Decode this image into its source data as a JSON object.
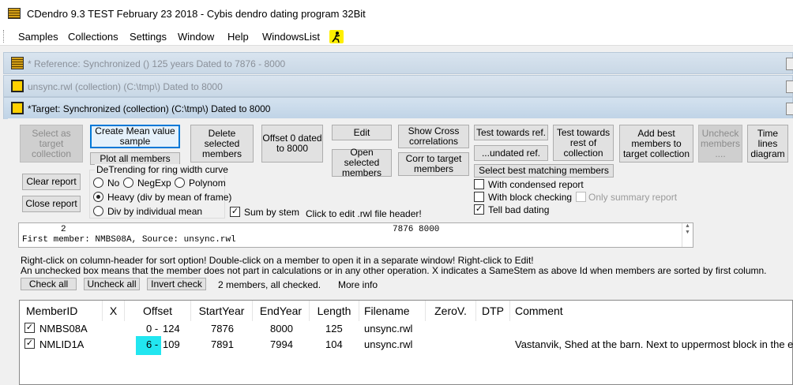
{
  "window": {
    "title": "CDendro 9.3  TEST February 23 2018 - Cybis dendro dating program  32Bit"
  },
  "menu": [
    {
      "key": "samples",
      "label": "Samples"
    },
    {
      "key": "collections",
      "label": "Collections"
    },
    {
      "key": "settings",
      "label": "Settings"
    },
    {
      "key": "window",
      "label": "Window"
    },
    {
      "key": "help",
      "label": "Help"
    },
    {
      "key": "windowslist",
      "label": "WindowsList"
    }
  ],
  "mdi": {
    "reference": "* Reference: Synchronized    ()  125 years  Dated to 7876 - 8000",
    "unsync": "unsync.rwl (collection)  (C:\\tmp\\) Dated to 8000",
    "target": "*Target: Synchronized (collection)  (C:\\tmp\\) Dated to 8000"
  },
  "buttons": {
    "select_target": "Select as target collection",
    "create_mean": "Create Mean value sample",
    "plot_all": "Plot all members",
    "delete_selected": "Delete selected members",
    "offset0": "Offset 0 dated to 8000",
    "edit": "Edit",
    "open_selected": "Open selected members",
    "show_cross": "Show Cross correlations",
    "corr_target": "Corr to target members",
    "test_ref": "Test towards ref.",
    "undated_ref": "...undated ref.",
    "test_rest": "Test towards rest of collection",
    "add_best": "Add best members to target collection",
    "uncheck_members": "Uncheck members ....",
    "time_lines": "Time lines diagram",
    "select_best": "Select best matching members",
    "clear_report": "Clear report",
    "close_report": "Close report",
    "check_all": "Check all",
    "uncheck_all": "Uncheck all",
    "invert_check": "Invert check"
  },
  "detrending": {
    "title": "DeTrending for ring width curve",
    "options": [
      "No",
      "NegExp",
      "Polynom",
      "Heavy (div by mean of frame)",
      "Div by individual mean"
    ],
    "selected": "Heavy (div by mean of frame)"
  },
  "checks": {
    "sum_by_stem": "Sum by stem",
    "condensed": "With condensed report",
    "block": "With block checking",
    "summary_only": "Only summary report",
    "tell_bad": "Tell bad dating"
  },
  "labels": {
    "click_edit": "Click to edit .rwl file header!",
    "hint1": "Right-click on column-header for sort option! Double-click on a member to open it in a separate window! Right-click to Edit!",
    "hint2": "An unchecked box means that the member does not part in calculations or in any other operation.  X indicates a SameStem as above Id when members are sorted by first column.",
    "status": "2 members, all checked.",
    "more_info": "More info"
  },
  "report": {
    "line1_a": "2",
    "line1_b": "7876 8000",
    "line2": "First member: NMBS08A, Source: unsync.rwl"
  },
  "table": {
    "columns": [
      "MemberID",
      "X",
      "Offset",
      "StartYear",
      "EndYear",
      "Length",
      "Filename",
      "ZeroV.",
      "DTP",
      "Comment"
    ],
    "rows": [
      {
        "checked": true,
        "id": "NMBS08A",
        "x": "",
        "offset_a": "0 -",
        "offset_b": "124",
        "start": "7876",
        "end": "8000",
        "length": "125",
        "file": "unsync.rwl",
        "zero": "",
        "dtp": "",
        "comment": ""
      },
      {
        "checked": true,
        "id": "NMLID1A",
        "x": "",
        "offset_a": "6 -",
        "offset_b": "109",
        "start": "7891",
        "end": "7994",
        "length": "104",
        "file": "unsync.rwl",
        "zero": "",
        "dtp": "",
        "comment": "Vastanvik, Shed at the barn. Next to uppermost block in the e"
      }
    ]
  },
  "colors": {
    "highlight": "#22e6f0",
    "default_button": "#0078d7"
  }
}
